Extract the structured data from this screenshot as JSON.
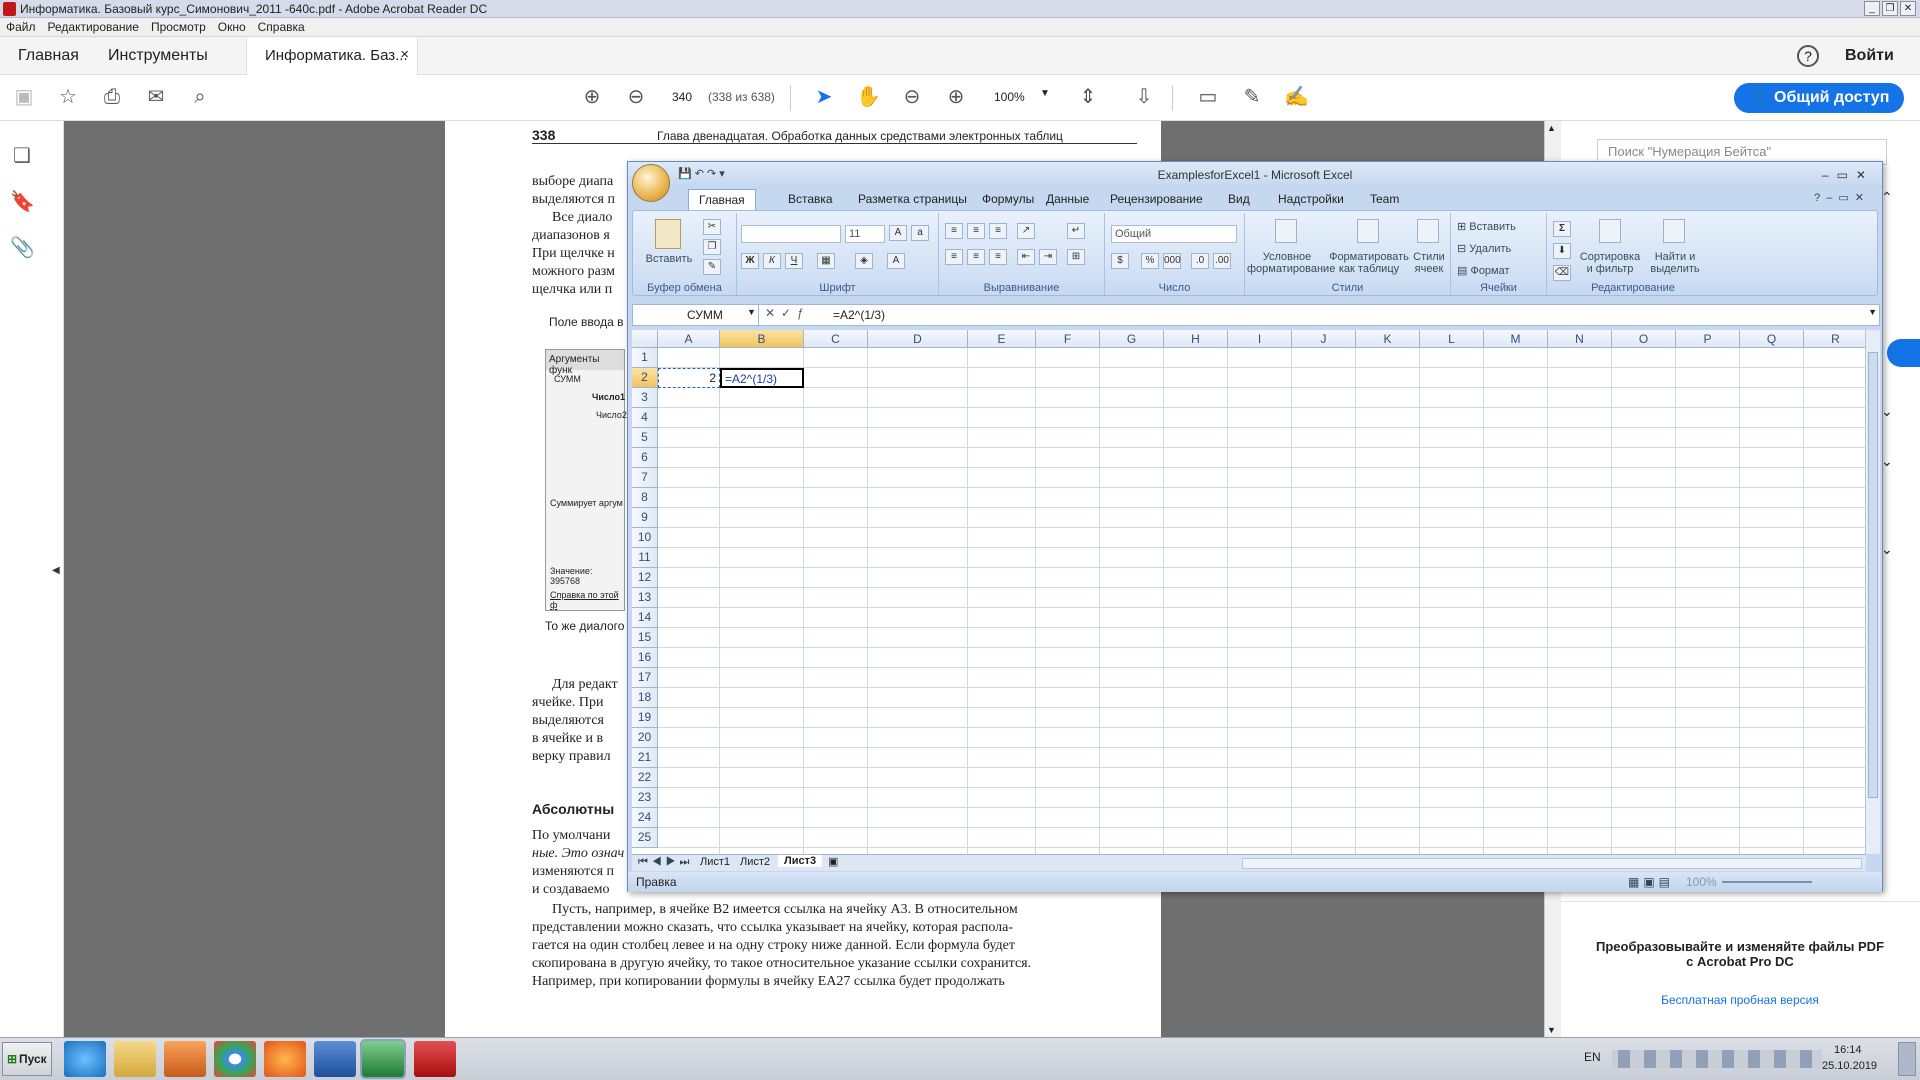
{
  "window": {
    "title": "Информатика. Базовый курс_Симонович_2011 -640с.pdf - Adobe Acrobat Reader DC"
  },
  "menu": [
    "Файл",
    "Редактирование",
    "Просмотр",
    "Окно",
    "Справка"
  ],
  "acrobat_tabs": {
    "home": "Главная",
    "tools": "Инструменты",
    "doc": "Информатика. Баз...",
    "close": "×",
    "signin": "Войти",
    "help": "?"
  },
  "toolbar": {
    "page_current": "340",
    "page_info": "(338 из 638)",
    "zoom": "100%",
    "share": "Общий доступ"
  },
  "pdf": {
    "page_num": "338",
    "header": "Глава двенадцатая. Обработка данных средствами электронных таблиц",
    "lines_top": [
      "выборе диапа",
      "выделяются п",
      "Все диало",
      "диапазонов я",
      "При щелчке н",
      "можного разм",
      "щелчка или п"
    ],
    "caption1": "Поле ввода в",
    "dialog": {
      "title": "Аргументы функ",
      "func": "СУММ",
      "n1": "Число1",
      "n2": "Число2",
      "desc": "Суммирует аргум",
      "value_label": "Значение:",
      "value": "395768",
      "help": "Справка по этой ф"
    },
    "caption2": "То же диалого",
    "lines_mid": [
      "Для редакт",
      "ячейке. При",
      "выделяются",
      "в ячейке и в",
      "верку правил"
    ],
    "heading": "Абсолютны",
    "lines_low": [
      "По умолчани",
      "ные. Это означ",
      "изменяются п",
      "и создаваемо"
    ],
    "paragraph": [
      "Пусть, например, в ячейке B2 имеется ссылка на ячейку A3. В относительном",
      "представлении можно сказать, что ссылка указывает на ячейку, которая распола-",
      "гается на один столбец левее и на одну строку ниже данной. Если формула будет",
      "скопирована в другую ячейку, то такое относительное указание ссылки сохранится.",
      "Например, при копировании формулы в ячейку EA27 ссылка будет продолжать"
    ]
  },
  "right_panel": {
    "search_placeholder": "Поиск \"Нумерация Бейтса\"",
    "promo": "Преобразовывайте и изменяйте файлы PDF с Acrobat Pro DC",
    "trial": "Бесплатная пробная версия"
  },
  "excel": {
    "title": "ExamplesforExcel1 - Microsoft Excel",
    "tabs": [
      "Главная",
      "Вставка",
      "Разметка страницы",
      "Формулы",
      "Данные",
      "Рецензирование",
      "Вид",
      "Надстройки",
      "Team"
    ],
    "groups": {
      "clipboard": "Буфер обмена",
      "paste": "Вставить",
      "font": "Шрифт",
      "font_size": "11",
      "align": "Выравнивание",
      "number": "Число",
      "number_format": "Общий",
      "styles": "Стили",
      "cond": "Условное форматирование",
      "astable": "Форматировать как таблицу",
      "cellstyles": "Стили ячеек",
      "cells": "Ячейки",
      "insert": "Вставить",
      "delete": "Удалить",
      "format": "Формат",
      "editing": "Редактирование",
      "sort": "Сортировка и фильтр",
      "find": "Найти и выделить"
    },
    "namebox": "СУММ",
    "formula": "=A2^(1/3)",
    "columns": [
      "A",
      "B",
      "C",
      "D",
      "E",
      "F",
      "G",
      "H",
      "I",
      "J",
      "K",
      "L",
      "M",
      "N",
      "O",
      "P",
      "Q",
      "R"
    ],
    "rows": [
      "1",
      "2",
      "3",
      "4",
      "5",
      "6",
      "7",
      "8",
      "9",
      "10",
      "11",
      "12",
      "13",
      "14",
      "15",
      "16",
      "17",
      "18",
      "19",
      "20",
      "21",
      "22",
      "23",
      "24",
      "25"
    ],
    "cells": {
      "A2": "2",
      "B2": "=A2^(1/3)"
    },
    "sheets": [
      "Лист1",
      "Лист2",
      "Лист3"
    ],
    "status": "Правка",
    "zoom": "100%"
  },
  "taskbar": {
    "start": "Пуск",
    "lang": "EN",
    "time": "16:14",
    "date": "25.10.2019"
  }
}
